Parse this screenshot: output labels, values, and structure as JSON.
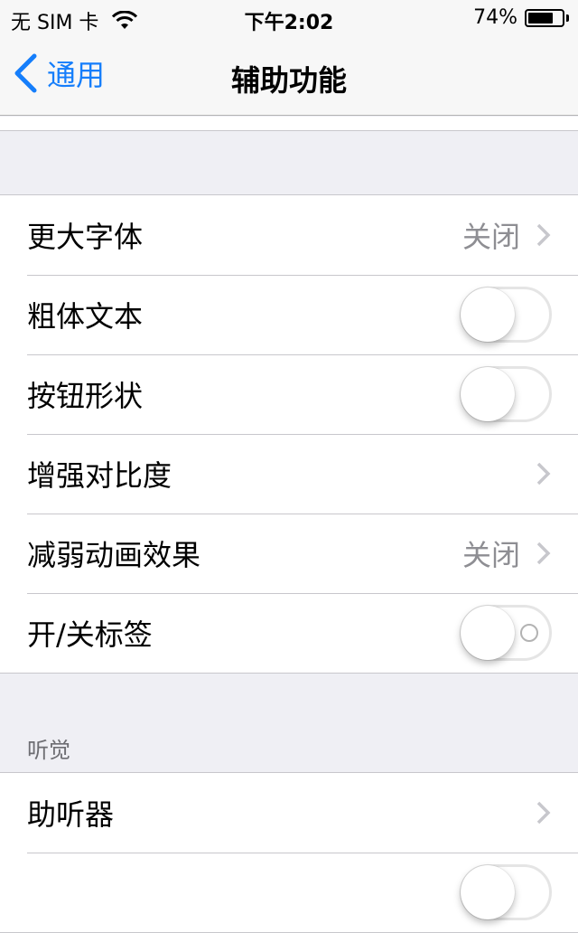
{
  "status_bar": {
    "carrier": "无 SIM 卡",
    "wifi_icon": "wifi-icon",
    "time": "下午2:02",
    "battery_percent_label": "74%",
    "battery_level": 0.74
  },
  "nav": {
    "back_label": "通用",
    "back_icon": "chevron-left-icon",
    "title": "辅助功能",
    "accent_color": "#157efb"
  },
  "group1": {
    "rows": [
      {
        "label": "更大字体",
        "type": "disclosure",
        "value": "关闭"
      },
      {
        "label": "粗体文本",
        "type": "toggle",
        "on": false
      },
      {
        "label": "按钮形状",
        "type": "toggle",
        "on": false
      },
      {
        "label": "增强对比度",
        "type": "disclosure",
        "value": ""
      },
      {
        "label": "减弱动画效果",
        "type": "disclosure",
        "value": "关闭"
      },
      {
        "label": "开/关标签",
        "type": "toggle",
        "on": false,
        "shows_off_label": true
      }
    ]
  },
  "hearing": {
    "header": "听觉",
    "rows": [
      {
        "label": "助听器",
        "type": "disclosure",
        "value": ""
      },
      {
        "label": "",
        "type": "toggle",
        "on": false
      }
    ]
  }
}
